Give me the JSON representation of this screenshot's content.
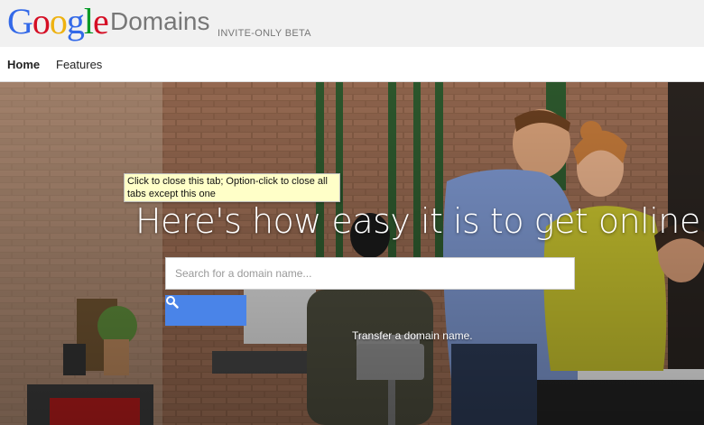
{
  "header": {
    "logo_letters": [
      {
        "ch": "G",
        "color": "#3369e8"
      },
      {
        "ch": "o",
        "color": "#d50f25"
      },
      {
        "ch": "o",
        "color": "#eeb211"
      },
      {
        "ch": "g",
        "color": "#3369e8"
      },
      {
        "ch": "l",
        "color": "#009925"
      },
      {
        "ch": "e",
        "color": "#d50f25"
      }
    ],
    "product": "Domains",
    "badge": "INVITE-ONLY BETA"
  },
  "nav": {
    "items": [
      {
        "label": "Home",
        "active": true
      },
      {
        "label": "Features",
        "active": false
      }
    ]
  },
  "hero": {
    "headline": "Here's how easy it is to get online",
    "search_placeholder": "Search for a domain name...",
    "search_icon": "search-icon",
    "transfer_link": "Transfer a domain name.",
    "accent_color": "#4a84e8"
  },
  "tooltip": {
    "text": "Click to close this tab; Option-click to close all tabs except this one"
  }
}
